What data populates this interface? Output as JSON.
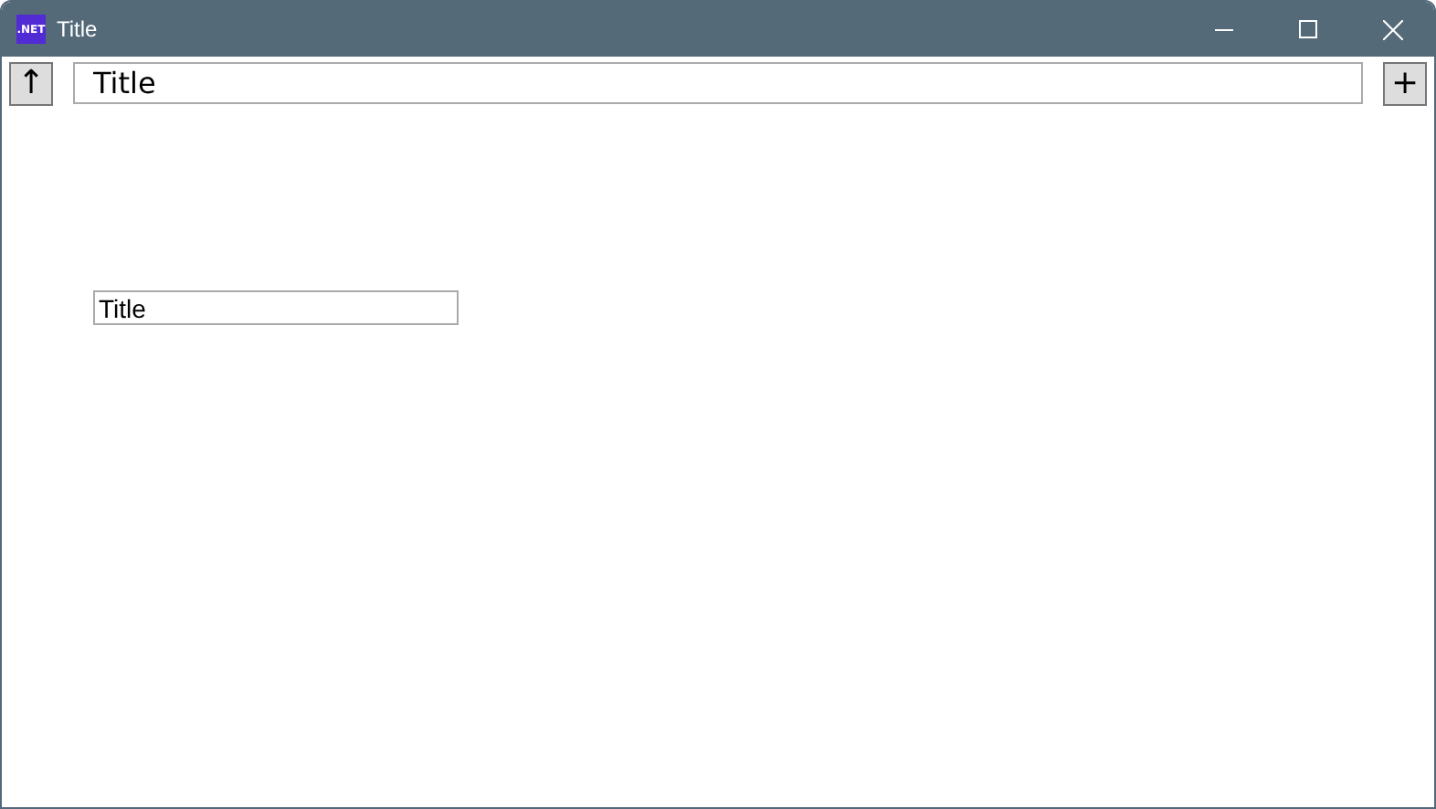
{
  "window": {
    "app_badge": ".NET",
    "title": "Title"
  },
  "toolbar": {
    "up_button": "↑",
    "path_field": {
      "value": "Title"
    },
    "add_button": "+"
  },
  "content": {
    "title_field": {
      "value": "Title"
    }
  }
}
